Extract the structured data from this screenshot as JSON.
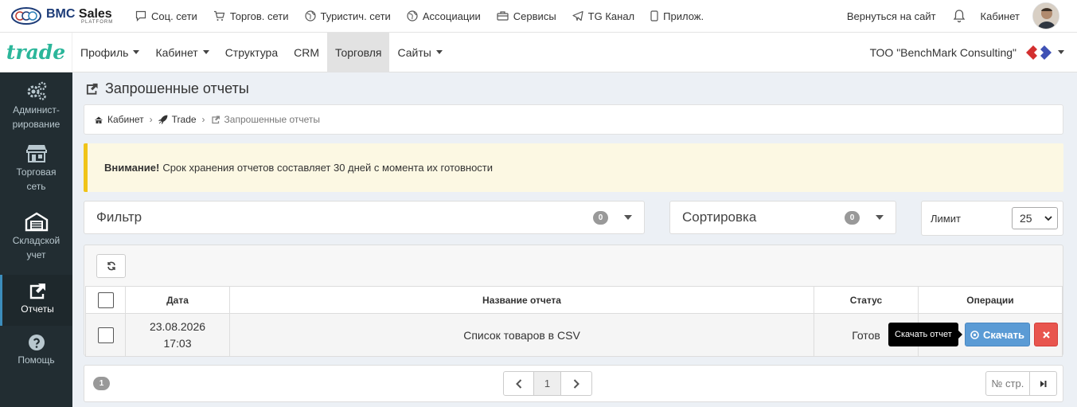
{
  "topbar": {
    "brand": "BMC",
    "brand_second": "Sales",
    "brand_sub": "PLATFORM",
    "links": [
      {
        "label": "Соц. сети",
        "icon": "chat-icon"
      },
      {
        "label": "Торгов. сети",
        "icon": "cart-icon"
      },
      {
        "label": "Туристич. сети",
        "icon": "globe-icon"
      },
      {
        "label": "Ассоциации",
        "icon": "globe-icon"
      },
      {
        "label": "Сервисы",
        "icon": "briefcase-icon"
      },
      {
        "label": "TG Канал",
        "icon": "telegram-icon"
      },
      {
        "label": "Прилож.",
        "icon": "mobile-icon"
      }
    ],
    "back_to_site": "Вернуться на сайт",
    "cabinet": "Кабинет"
  },
  "navbar": {
    "logo": "trade",
    "items": [
      {
        "label": "Профиль",
        "dropdown": true
      },
      {
        "label": "Кабинет",
        "dropdown": true
      },
      {
        "label": "Структура",
        "dropdown": false
      },
      {
        "label": "CRM",
        "dropdown": false
      },
      {
        "label": "Торговля",
        "dropdown": false,
        "active": true
      },
      {
        "label": "Сайты",
        "dropdown": true
      }
    ],
    "company": "ТОО \"BenchMark Consulting\""
  },
  "sidebar": {
    "items": [
      {
        "label": "Админист-\nрирование",
        "line1": "Админист-",
        "line2": "рирование",
        "icon": "gears-icon"
      },
      {
        "label": "Торговая сеть",
        "line1": "Торговая",
        "line2": "сеть",
        "icon": "store-icon"
      },
      {
        "label": "Складской учет",
        "line1": "Складской",
        "line2": "учет",
        "icon": "warehouse-icon"
      },
      {
        "label": "Отчеты",
        "line1": "Отчеты",
        "line2": "",
        "icon": "share-icon",
        "active": true
      },
      {
        "label": "Помощь",
        "line1": "Помощь",
        "line2": "",
        "icon": "help-icon"
      }
    ]
  },
  "page": {
    "title": "Запрошенные отчеты",
    "breadcrumb": [
      "Кабинет",
      "Trade",
      "Запрошенные отчеты"
    ],
    "alert_strong": "Внимание!",
    "alert_text": "Срок хранения отчетов составляет 30 дней с момента их готовности"
  },
  "filter": {
    "label": "Фильтр",
    "count": "0"
  },
  "sort": {
    "label": "Сортировка",
    "count": "0"
  },
  "limit": {
    "label": "Лимит",
    "value": "25"
  },
  "table": {
    "headers": [
      "Дата",
      "Название отчета",
      "Статус",
      "Операции"
    ],
    "rows": [
      {
        "date": "23.08.2026",
        "time": "17:03",
        "name": "Список товаров в CSV",
        "status": "Готов"
      }
    ],
    "tooltip": "Скачать отчет",
    "download_label": "Скачать"
  },
  "pager": {
    "total": "1",
    "current": "1",
    "page_input_placeholder": "№ стр."
  },
  "colors": {
    "sidebar_bg": "#222d32",
    "accent": "#3c8dbc",
    "download_btn": "#5b9bd5",
    "delete_btn": "#e8554e",
    "trade_logo": "#2bb69a",
    "alert_bg": "#fcf8e3"
  }
}
